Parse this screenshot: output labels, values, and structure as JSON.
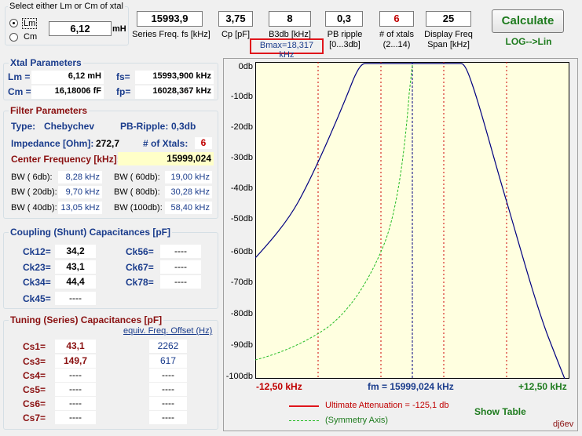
{
  "mode_select": {
    "title": "Select either Lm or Cm of xtal",
    "options": [
      "Lm",
      "Cm"
    ],
    "selected": "Lm",
    "value": "6,12",
    "unit": "mH"
  },
  "top_fields": [
    {
      "value": "15993,9",
      "label": "Series Freq. fs [kHz]",
      "color": "#000"
    },
    {
      "value": "3,75",
      "label": "Cp [pF]",
      "color": "#000"
    },
    {
      "value": "8",
      "label": "B3db [kHz]",
      "color": "#000"
    },
    {
      "value": "0,3",
      "label": "PB ripple\n[0...3db]",
      "color": "#000"
    },
    {
      "value": "6",
      "label": "# of xtals\n(2...14)",
      "color": "#c00000"
    },
    {
      "value": "25",
      "label": "Display Freq\nSpan [kHz]",
      "color": "#000"
    }
  ],
  "bmax": "Bmax=18,317 kHz",
  "calculate_label": "Calculate",
  "log_lin_label": "LOG-->Lin",
  "xtal": {
    "title": "Xtal Parameters",
    "lm_label": "Lm =",
    "lm_value": "6,12 mH",
    "fs_label": "fs=",
    "fs_value": "15993,900 kHz",
    "cm_label": "Cm =",
    "cm_value": "16,18006 fF",
    "fp_label": "fp=",
    "fp_value": "16028,367 kHz"
  },
  "filter": {
    "title": "Filter Parameters",
    "type_label": "Type:",
    "type_value": "Chebychev",
    "ripple_label": "PB-Ripple:",
    "ripple_value": "0,3db",
    "imp_label": "Impedance [Ohm]:",
    "imp_value": "272,7",
    "nx_label": "# of Xtals:",
    "nx_value": "6",
    "cf_label": "Center Frequency [kHz]:",
    "cf_value": "15999,024",
    "bw": [
      {
        "label": "BW (  6db):",
        "value": "8,28 kHz"
      },
      {
        "label": "BW ( 60db):",
        "value": "19,00 kHz"
      },
      {
        "label": "BW ( 20db):",
        "value": "9,70 kHz"
      },
      {
        "label": "BW ( 80db):",
        "value": "30,28 kHz"
      },
      {
        "label": "BW ( 40db):",
        "value": "13,05 kHz"
      },
      {
        "label": "BW (100db):",
        "value": "58,40 kHz"
      }
    ]
  },
  "coupling": {
    "title": "Coupling (Shunt) Capacitances [pF]",
    "items": [
      {
        "label": "Ck12=",
        "value": "34,2"
      },
      {
        "label": "Ck56=",
        "value": "----"
      },
      {
        "label": "Ck23=",
        "value": "43,1"
      },
      {
        "label": "Ck67=",
        "value": "----"
      },
      {
        "label": "Ck34=",
        "value": "44,4"
      },
      {
        "label": "Ck78=",
        "value": "----"
      },
      {
        "label": "Ck45=",
        "value": "----"
      }
    ]
  },
  "tuning": {
    "title": "Tuning (Series) Capacitances [pF]",
    "offset_label": "equiv. Freq. Offset (Hz)",
    "rows": [
      {
        "label": "Cs1=",
        "value": "43,1",
        "offset": "2262"
      },
      {
        "label": "Cs3=",
        "value": "149,7",
        "offset": "617"
      },
      {
        "label": "Cs4=",
        "value": "----",
        "offset": "----"
      },
      {
        "label": "Cs5=",
        "value": "----",
        "offset": "----"
      },
      {
        "label": "Cs6=",
        "value": "----",
        "offset": "----"
      },
      {
        "label": "Cs7=",
        "value": "----",
        "offset": "----"
      }
    ]
  },
  "chart": {
    "y_labels": [
      "0db",
      "-10db",
      "-20db",
      "-30db",
      "-40db",
      "-50db",
      "-60db",
      "-70db",
      "-80db",
      "-90db",
      "-100db"
    ],
    "x_left": "-12,50 kHz",
    "x_center": "fm = 15999,024 kHz",
    "x_right": "+12,50 kHz",
    "legend_ult": "Ultimate Attenuation =   -125,1 db",
    "legend_sym": "(Symmetry Axis)",
    "show_table": "Show Table",
    "signature": "dj6ev",
    "colors": {
      "bg": "#ffffe0",
      "response": "#000080",
      "green": "#22bb22",
      "grid": "#cc0000"
    }
  }
}
